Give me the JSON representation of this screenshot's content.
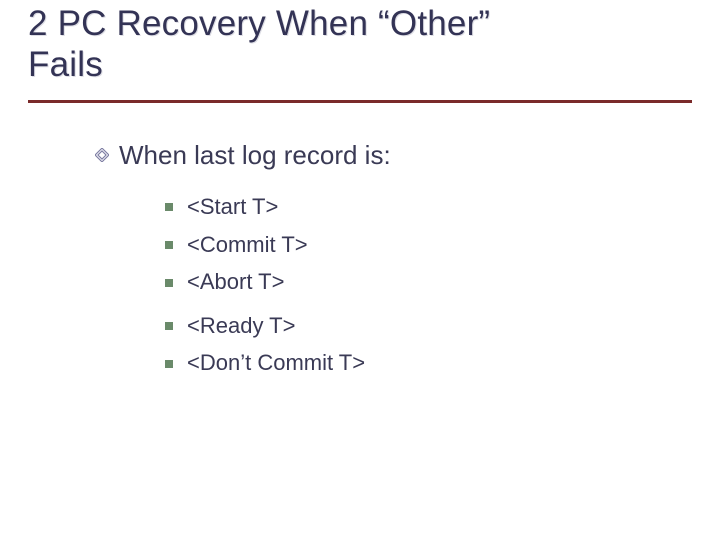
{
  "title": {
    "line1": "2 PC Recovery When “Other”",
    "line2": "Fails"
  },
  "body": {
    "level1": {
      "text": "When last log record is:"
    },
    "level2": {
      "items": [
        "<Start T>",
        "<Commit T>",
        "<Abort T>",
        "<Ready T>",
        "<Don’t Commit T>"
      ]
    }
  },
  "colors": {
    "title_rule": "#7a2a2a",
    "square_bullet": "#6a8a6a",
    "text": "#3a3a55"
  }
}
